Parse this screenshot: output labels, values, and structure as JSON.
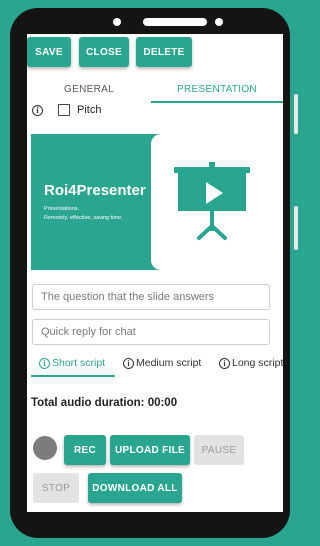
{
  "toolbar": {
    "save": "SAVE",
    "close": "CLOSE",
    "delete": "DELETE"
  },
  "tabs": [
    {
      "label": "GENERAL",
      "active": false
    },
    {
      "label": "PRESENTATION",
      "active": true
    }
  ],
  "pitch": {
    "label": "Pitch",
    "checked": false,
    "info_icon": "i"
  },
  "slide": {
    "title": "Roi4Presenter",
    "subtitle_line1": "Presentations.",
    "subtitle_line2": "Remotely, effective, saving time."
  },
  "fields": {
    "question_placeholder": "The question that the slide answers",
    "reply_placeholder": "Quick reply for chat"
  },
  "script_tabs": [
    {
      "label": "Short script",
      "icon": "i",
      "active": true
    },
    {
      "label": "Medium script",
      "icon": "i",
      "active": false
    },
    {
      "label": "Long script",
      "icon": "i",
      "active": false
    }
  ],
  "audio": {
    "duration_text": "Total audio duration: 00:00"
  },
  "controls": {
    "rec": "REC",
    "upload": "UPLOAD FILE",
    "pause": "PAUSE",
    "stop": "STOP",
    "download": "DOWNLOAD ALL"
  },
  "colors": {
    "accent": "#2aa58f",
    "background": "#2aa58f",
    "phone_frame": "#141414",
    "disabled": "#e2e2e2",
    "record_dot": "#7c7c7c"
  },
  "icons": {
    "presentation": "projector-screen-play-icon",
    "info": "info-icon",
    "record": "record-dot-icon"
  }
}
